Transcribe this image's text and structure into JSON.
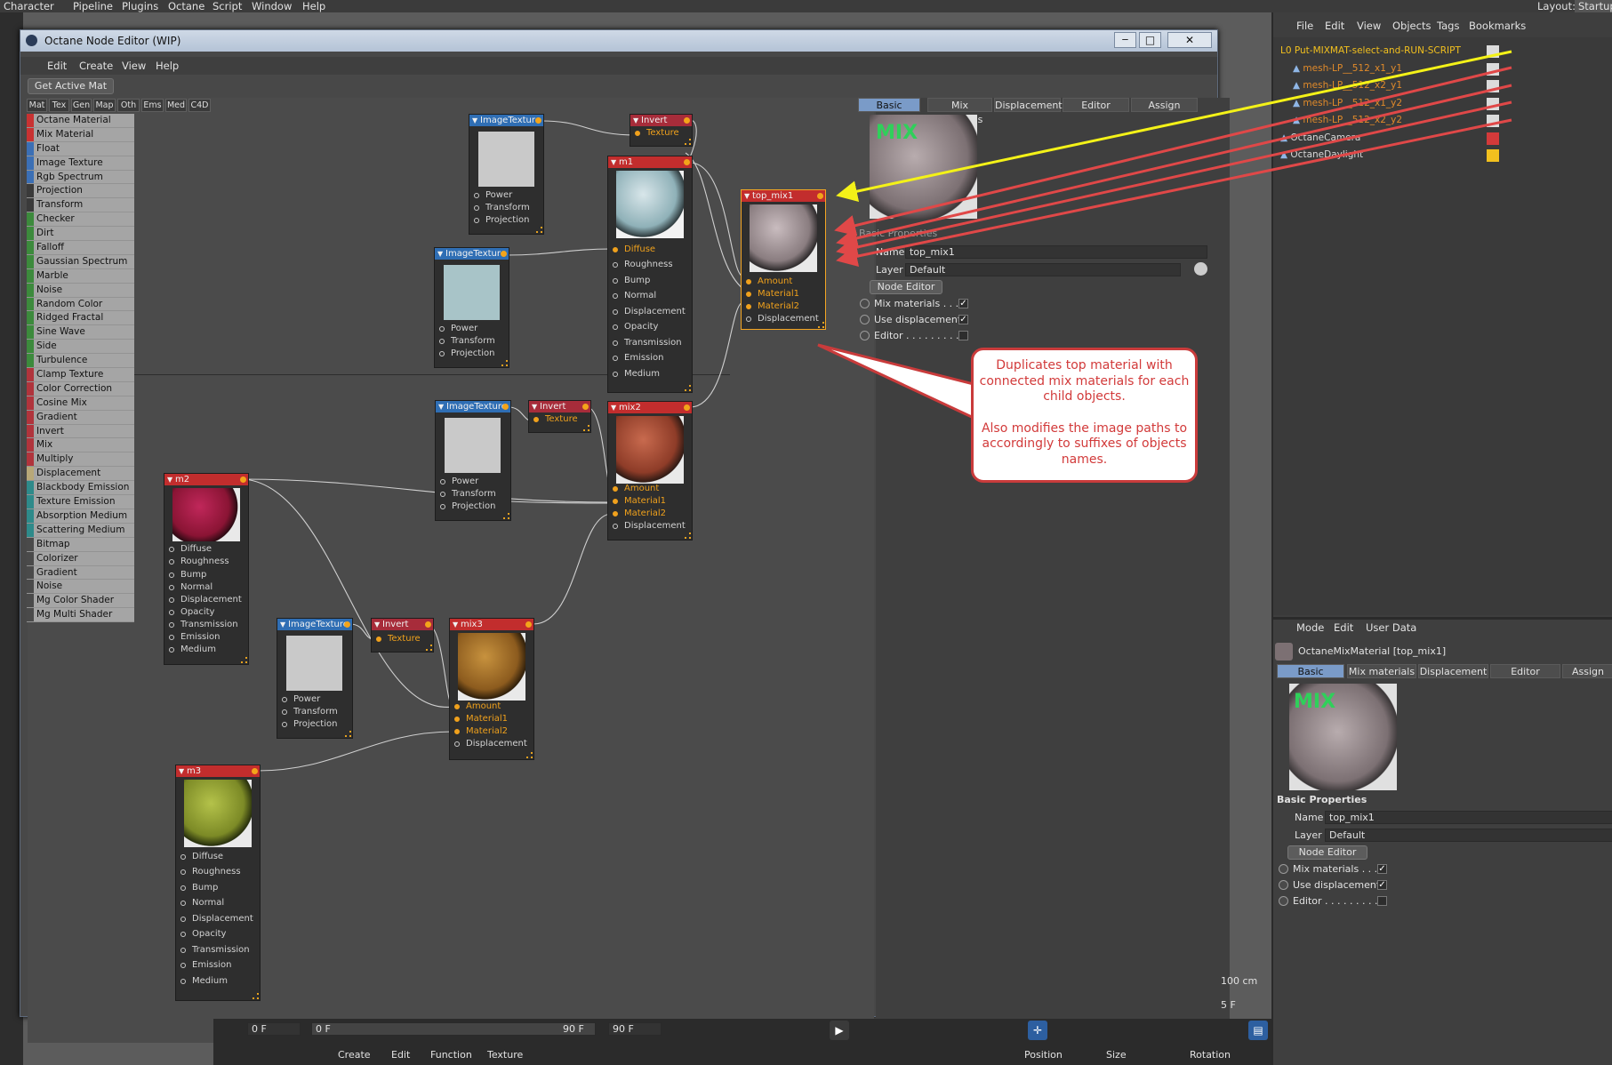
{
  "top_menu": {
    "items": [
      "Character",
      "Pipeline",
      "Plugins",
      "Octane",
      "Script",
      "Window",
      "Help"
    ],
    "layout_label": "Layout:",
    "layout_value": "Startup"
  },
  "node_editor": {
    "title": "Octane Node Editor (WIP)",
    "menu": [
      "Edit",
      "Create",
      "View",
      "Help"
    ],
    "get_active_mat": "Get Active Mat",
    "palette_tabs": [
      "Mat",
      "Tex",
      "Gen",
      "Map",
      "Oth",
      "Ems",
      "Med",
      "C4D"
    ],
    "palette_items": [
      {
        "label": "Octane Material",
        "color": "#c83232"
      },
      {
        "label": "Mix Material",
        "color": "#c83232"
      },
      {
        "label": "Float",
        "color": "#3b6fb5"
      },
      {
        "label": "Image Texture",
        "color": "#3b6fb5"
      },
      {
        "label": "Rgb Spectrum",
        "color": "#3b6fb5"
      },
      {
        "label": "Projection",
        "color": "#3a3a3a"
      },
      {
        "label": "Transform",
        "color": "#3a3a3a"
      },
      {
        "label": "Checker",
        "color": "#3c8a3c"
      },
      {
        "label": "Dirt",
        "color": "#3c8a3c"
      },
      {
        "label": "Falloff",
        "color": "#3c8a3c"
      },
      {
        "label": "Gaussian Spectrum",
        "color": "#3c8a3c"
      },
      {
        "label": "Marble",
        "color": "#3c8a3c"
      },
      {
        "label": "Noise",
        "color": "#3c8a3c"
      },
      {
        "label": "Random Color",
        "color": "#3c8a3c"
      },
      {
        "label": "Ridged Fractal",
        "color": "#3c8a3c"
      },
      {
        "label": "Sine Wave",
        "color": "#3c8a3c"
      },
      {
        "label": "Side",
        "color": "#3c8a3c"
      },
      {
        "label": "Turbulence",
        "color": "#3c8a3c"
      },
      {
        "label": "Clamp Texture",
        "color": "#b0343c"
      },
      {
        "label": "Color Correction",
        "color": "#b0343c"
      },
      {
        "label": "Cosine Mix",
        "color": "#b0343c"
      },
      {
        "label": "Gradient",
        "color": "#b0343c"
      },
      {
        "label": "Invert",
        "color": "#b0343c"
      },
      {
        "label": "Mix",
        "color": "#b0343c"
      },
      {
        "label": "Multiply",
        "color": "#b0343c"
      },
      {
        "label": "Displacement",
        "color": "#b8a878"
      },
      {
        "label": "Blackbody Emission",
        "color": "#2e8a8a"
      },
      {
        "label": "Texture Emission",
        "color": "#2e8a8a"
      },
      {
        "label": "Absorption Medium",
        "color": "#2e8a8a"
      },
      {
        "label": "Scattering Medium",
        "color": "#2e8a8a"
      },
      {
        "label": "Bitmap",
        "color": "#4a4a4a"
      },
      {
        "label": "Colorizer",
        "color": "#4a4a4a"
      },
      {
        "label": "Gradient",
        "color": "#4a4a4a"
      },
      {
        "label": "Noise",
        "color": "#4a4a4a"
      },
      {
        "label": "Mg Color Shader",
        "color": "#4a4a4a"
      },
      {
        "label": "Mg Multi Shader",
        "color": "#4a4a4a"
      }
    ]
  },
  "nodes": {
    "imgtex_top": {
      "title": "ImageTexture",
      "ports": [
        "Power",
        "Transform",
        "Projection"
      ]
    },
    "invert_top": {
      "title": "Invert",
      "ports": [
        "Texture"
      ]
    },
    "m1": {
      "title": "m1",
      "ports": [
        "Diffuse",
        "Roughness",
        "Bump",
        "Normal",
        "Displacement",
        "Opacity",
        "Transmission",
        "Emission",
        "Medium"
      ]
    },
    "imgtex_mid": {
      "title": "ImageTexture",
      "ports": [
        "Power",
        "Transform",
        "Projection"
      ]
    },
    "top_mix1": {
      "title": "top_mix1",
      "ports": [
        "Amount",
        "Material1",
        "Material2",
        "Displacement"
      ]
    },
    "imgtex_3": {
      "title": "ImageTexture",
      "ports": [
        "Power",
        "Transform",
        "Projection"
      ]
    },
    "invert_mid": {
      "title": "Invert",
      "ports": [
        "Texture"
      ]
    },
    "mix2": {
      "title": "mix2",
      "ports": [
        "Amount",
        "Material1",
        "Material2",
        "Displacement"
      ]
    },
    "m2": {
      "title": "m2",
      "ports": [
        "Diffuse",
        "Roughness",
        "Bump",
        "Normal",
        "Displacement",
        "Opacity",
        "Transmission",
        "Emission",
        "Medium"
      ]
    },
    "imgtex_4": {
      "title": "ImageTexture",
      "ports": [
        "Power",
        "Transform",
        "Projection"
      ]
    },
    "invert_low": {
      "title": "Invert",
      "ports": [
        "Texture"
      ]
    },
    "mix3": {
      "title": "mix3",
      "ports": [
        "Amount",
        "Material1",
        "Material2",
        "Displacement"
      ]
    },
    "m3": {
      "title": "m3",
      "ports": [
        "Diffuse",
        "Roughness",
        "Bump",
        "Normal",
        "Displacement",
        "Opacity",
        "Transmission",
        "Emission",
        "Medium"
      ]
    }
  },
  "attributes": {
    "tabs": [
      "Basic",
      "Mix materials",
      "Displacement",
      "Editor",
      "Assign"
    ],
    "preview_label": "MIX",
    "section": "Basic Properties",
    "name_label": "Name",
    "name_value": "top_mix1",
    "layer_label": "Layer",
    "layer_value": "Default",
    "node_editor_button": "Node Editor",
    "mix_materials": "Mix materials . . . .",
    "use_displacement": "Use displacement",
    "editor": "Editor . . . . . . . . . .",
    "check_mark": "✓"
  },
  "callout": {
    "line1": "Duplicates top material with connected mix materials for each child objects.",
    "line2": "Also modifies the image paths to accordingly to suffixes of objects names."
  },
  "object_manager": {
    "menu": [
      "File",
      "Edit",
      "View",
      "Objects",
      "Tags",
      "Bookmarks"
    ],
    "objects": [
      {
        "name": "Put-MIXMAT-select-and-RUN-SCRIPT",
        "color": "#f2c01e"
      },
      {
        "name": "mesh-LP__512_x1_y1",
        "color": "#e08a2a"
      },
      {
        "name": "mesh-LP__512_x2_y1",
        "color": "#e08a2a"
      },
      {
        "name": "mesh-LP__512_x1_y2",
        "color": "#e08a2a"
      },
      {
        "name": "mesh-LP__512_x2_y2",
        "color": "#e08a2a"
      },
      {
        "name": "OctaneCamera",
        "color": "#d8d8d8"
      },
      {
        "name": "OctaneDaylight",
        "color": "#d8d8d8"
      }
    ]
  },
  "attribute_manager": {
    "menu": [
      "Mode",
      "Edit",
      "User Data"
    ],
    "object_title": "OctaneMixMaterial [top_mix1]",
    "tabs": [
      "Basic",
      "Mix materials",
      "Displacement",
      "Editor",
      "Assign"
    ],
    "preview_label": "MIX",
    "section": "Basic Properties",
    "name_label": "Name",
    "name_value": "top_mix1",
    "layer_label": "Layer",
    "layer_value": "Default",
    "node_editor_button": "Node Editor",
    "mix_materials": "Mix materials . . . .",
    "use_displacement": "Use displacement",
    "editor": "Editor . . . . . . . . . .",
    "check_mark": "✓"
  },
  "timeline": {
    "frame_start": "0 F",
    "frame_field": "0 F",
    "frame_end_field": "90 F",
    "frame_end": "90 F",
    "scale_label": "100 cm",
    "menu": [
      "Create",
      "Edit",
      "Function",
      "Texture"
    ],
    "coords": [
      "Position",
      "Size",
      "Rotation"
    ],
    "right_frame": "5 F"
  },
  "colors": {
    "accent_arrow_yellow": "#f4f218",
    "accent_arrow_red": "#e04848",
    "node_selected": "#f5a623"
  }
}
